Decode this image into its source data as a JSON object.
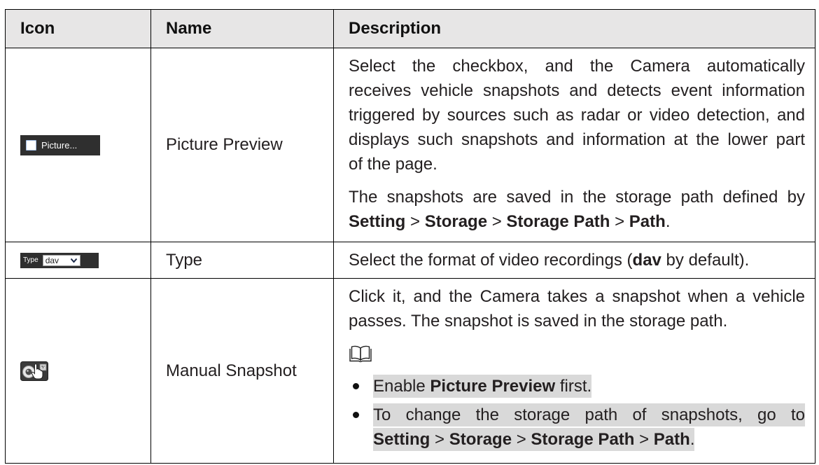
{
  "colors": {
    "header_background": "#e7e6e6",
    "highlight": "#d9d9d9",
    "icon_background": "#2f2f2f",
    "border": "#000000",
    "text": "#231f20"
  },
  "table": {
    "headers": {
      "icon": "Icon",
      "name": "Name",
      "description": "Description"
    },
    "rows": [
      {
        "icon": {
          "name": "checkbox-icon",
          "label": "Picture..."
        },
        "name": "Picture Preview",
        "description": {
          "paragraph1": [
            "Select the checkbox, and the Camera automatically",
            "receives vehicle snapshots and detects event information",
            "triggered by sources such as radar or video detection, and",
            "displays such snapshots and information at the lower part",
            "of the page."
          ],
          "paragraph2": {
            "line1": "The snapshots are saved in the storage path defined by",
            "line2": [
              "Setting",
              " > ",
              "Storage",
              " > ",
              "Storage Path",
              " > ",
              "Path",
              "."
            ]
          }
        }
      },
      {
        "icon": {
          "name": "dropdown-icon",
          "label": "Type",
          "value": "dav"
        },
        "name": "Type",
        "description": [
          "Select the format of video recordings (",
          "dav",
          " by default)."
        ]
      },
      {
        "icon": {
          "name": "manual-snapshot-icon"
        },
        "name": "Manual Snapshot",
        "description": {
          "lines": [
            "Click it, and the Camera takes a snapshot when a vehicle",
            "passes. The snapshot is saved in the storage path."
          ],
          "note_icon": "book-icon",
          "bullet1": [
            "Enable ",
            "Picture Preview",
            " first."
          ],
          "bullet2": {
            "line1": "To change the storage path of snapshots, go to",
            "line2": [
              "Setting",
              " > ",
              "Storage",
              " > ",
              "Storage Path",
              " > ",
              "Path",
              "."
            ]
          }
        }
      }
    ]
  }
}
